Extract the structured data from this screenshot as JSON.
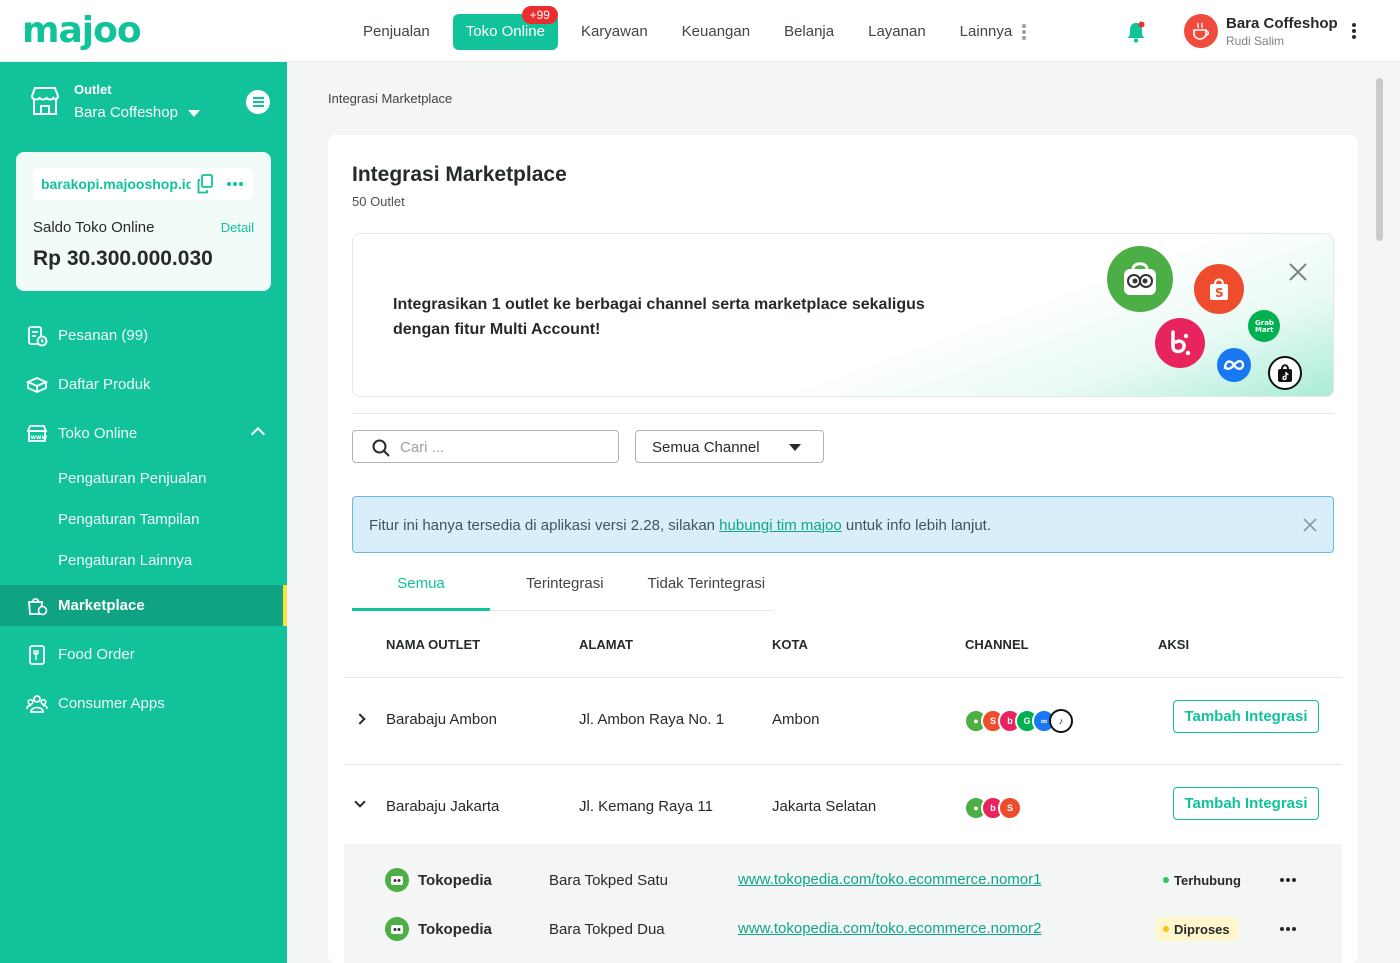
{
  "brand": {
    "logo": "majoo",
    "accent": "#11c29a"
  },
  "topnav": {
    "items": [
      {
        "label": "Penjualan"
      },
      {
        "label": "Toko Online",
        "badge": "+99",
        "active": true
      },
      {
        "label": "Karyawan"
      },
      {
        "label": "Keuangan"
      },
      {
        "label": "Belanja"
      },
      {
        "label": "Layanan"
      },
      {
        "label": "Lainnya"
      }
    ]
  },
  "profile": {
    "name": "Bara Coffeshop",
    "user": "Rudi Salim"
  },
  "sidebar": {
    "outlet_label": "Outlet",
    "outlet_name": "Bara Coffeshop",
    "card": {
      "store_url": "barakopi.majooshop.id",
      "saldo_label": "Saldo Toko Online",
      "detail_label": "Detail",
      "saldo_value": "Rp 30.300.000.030"
    },
    "menu": {
      "pesanan": "Pesanan (99)",
      "daftar_produk": "Daftar Produk",
      "toko_online": "Toko Online",
      "sub": [
        "Pengaturan Penjualan",
        "Pengaturan Tampilan",
        "Pengaturan Lainnya"
      ],
      "marketplace": "Marketplace",
      "food_order": "Food Order",
      "consumer_apps": "Consumer Apps"
    }
  },
  "main": {
    "breadcrumb": "Integrasi Marketplace",
    "title": "Integrasi Marketplace",
    "subtitle": "50 Outlet",
    "banner_text": "Integrasikan 1 outlet ke berbagai channel serta marketplace sekaligus dengan fitur Multi Account!",
    "search_placeholder": "Cari ...",
    "channel_select": "Semua Channel",
    "alert": {
      "before": "Fitur ini hanya tersedia di aplikasi versi 2.28, silakan ",
      "link": "hubungi tim majoo",
      "after": " untuk info lebih lanjut."
    },
    "tabs": [
      "Semua",
      "Terintegrasi",
      "Tidak Terintegrasi"
    ],
    "table": {
      "headers": [
        "NAMA OUTLET",
        "ALAMAT",
        "KOTA",
        "CHANNEL",
        "AKSI"
      ],
      "rows": [
        {
          "name": "Barabaju Ambon",
          "address": "Jl. Ambon Raya No. 1",
          "city": "Ambon",
          "action": "Tambah Integrasi"
        },
        {
          "name": "Barabaju Jakarta",
          "address": "Jl. Kemang Raya 11",
          "city": "Jakarta Selatan",
          "action": "Tambah Integrasi"
        }
      ],
      "subrows": [
        {
          "channel": "Tokopedia",
          "store": "Bara Tokped Satu",
          "url": "www.tokopedia.com/toko.ecommerce.nomor1",
          "status": "Terhubung"
        },
        {
          "channel": "Tokopedia",
          "store": "Bara Tokped Dua",
          "url": "www.tokopedia.com/toko.ecommerce.nomor2",
          "status": "Diproses"
        }
      ]
    }
  },
  "channel_colors": {
    "tokopedia": "#4caf45",
    "shopee": "#ee4d2d",
    "blibli_like": "#e8245f",
    "grabmart": "#00b14f",
    "meta": "#1877f2",
    "tiktok": "#111111"
  }
}
